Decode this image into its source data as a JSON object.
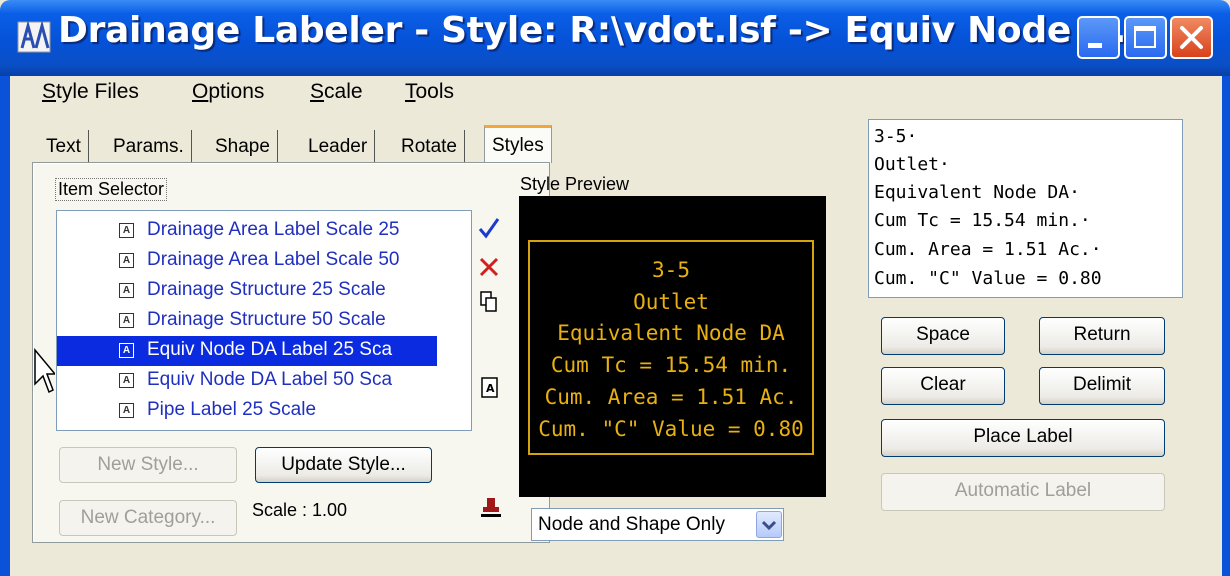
{
  "window": {
    "title": "Drainage Labeler - Style: R:\\vdot.lsf -> Equiv Node D...",
    "minimize_icon": "minimize-icon",
    "maximize_icon": "maximize-icon",
    "close_icon": "close-icon"
  },
  "menu": [
    "Style Files",
    "Options",
    "Scale",
    "Tools"
  ],
  "tabs": [
    "Text",
    "Params.",
    "Shape",
    "Leader",
    "Rotate",
    "Styles"
  ],
  "active_tab": "Styles",
  "item_selector": {
    "label": "Item Selector",
    "items": [
      "Drainage Area Label Scale 25",
      "Drainage Area Label Scale 50",
      "Drainage Structure 25 Scale",
      "Drainage Structure 50 Scale",
      "Equiv Node DA Label 25 Sca",
      "Equiv Node DA Label 50 Sca",
      "Pipe Label 25 Scale"
    ],
    "selected_index": 4,
    "item_icon": "label-style-icon"
  },
  "tools": {
    "accept_icon": "checkmark-icon",
    "delete_icon": "delete-x-icon",
    "copy_icon": "copy-icon",
    "paste_icon": "paste-label-icon",
    "stamp_icon": "stamp-icon"
  },
  "style_preview": {
    "label": "Style Preview",
    "lines": [
      "3-5",
      "Outlet",
      "Equivalent Node DA",
      "Cum Tc = 15.54 min.",
      "Cum. Area = 1.51 Ac.",
      "Cum. \"C\" Value = 0.80"
    ],
    "text_color": "#e8b010",
    "background": "#000000",
    "display_mode": "Node and Shape Only"
  },
  "buttons": {
    "new_style": "New Style...",
    "update_style": "Update Style...",
    "new_category": "New Category...",
    "space": "Space",
    "return": "Return",
    "clear": "Clear",
    "delimit": "Delimit",
    "place_label": "Place Label",
    "automatic_label": "Automatic Label"
  },
  "scale_text": "Scale : 1.00",
  "label_text": {
    "lines": [
      "3-5·",
      "Outlet·",
      "Equivalent Node DA·",
      "Cum Tc = 15.54 min.·",
      "Cum. Area = 1.51 Ac.·",
      "Cum.  \"C\" Value = 0.80"
    ]
  },
  "colors": {
    "title_bar": "#0552d8",
    "selection": "#0a2be0",
    "list_text": "#1f2fc0",
    "tab_highlight": "#f3a73a"
  }
}
